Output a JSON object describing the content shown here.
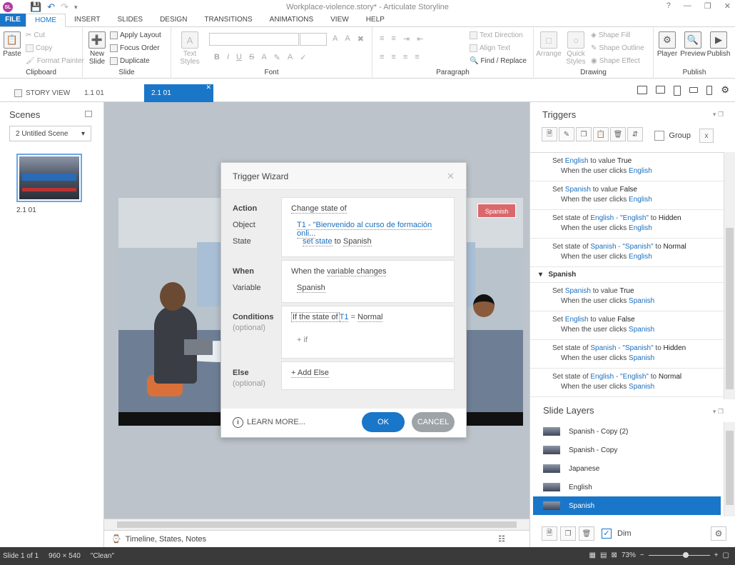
{
  "window": {
    "title": "Workplace-violence.story* - Articulate Storyline",
    "logo": "SL"
  },
  "tabs": [
    "FILE",
    "HOME",
    "INSERT",
    "SLIDES",
    "DESIGN",
    "TRANSITIONS",
    "ANIMATIONS",
    "VIEW",
    "HELP"
  ],
  "ribbon": {
    "clipboard": {
      "label": "Clipboard",
      "paste": "Paste",
      "cut": "Cut",
      "copy": "Copy",
      "format_painter": "Format Painter"
    },
    "slide": {
      "label": "Slide",
      "new_slide": "New Slide",
      "apply_layout": "Apply Layout",
      "focus_order": "Focus Order",
      "duplicate": "Duplicate"
    },
    "font": {
      "label": "Font",
      "text_styles": "Text Styles"
    },
    "paragraph": {
      "label": "Paragraph",
      "text_direction": "Text Direction",
      "align_text": "Align Text",
      "find_replace": "Find / Replace"
    },
    "drawing": {
      "label": "Drawing",
      "arrange": "Arrange",
      "quick_styles": "Quick Styles",
      "shape_fill": "Shape Fill",
      "shape_outline": "Shape Outline",
      "shape_effect": "Shape Effect"
    },
    "publish": {
      "label": "Publish",
      "player": "Player",
      "preview": "Preview",
      "publish": "Publish"
    }
  },
  "viewbar": {
    "story_view": "STORY VIEW",
    "tab1": "1.1 01",
    "tab2": "2.1 01"
  },
  "scenes": {
    "title": "Scenes",
    "dropdown": "2 Untitled Scene",
    "thumb_label": "2.1 01"
  },
  "slide": {
    "spanish_button": "Spanish"
  },
  "timeline_bar": "Timeline, States, Notes",
  "dialog": {
    "title": "Trigger Wizard",
    "action": {
      "label": "Action",
      "object_label": "Object",
      "state_label": "State",
      "action_value": "Change state of",
      "object_value": "T1 - \"Bienvenido al curso de formación onli...",
      "state_prefix": "set state",
      "state_to": "to",
      "state_value": "Spanish"
    },
    "when": {
      "label": "When",
      "variable_label": "Variable",
      "when_prefix": "When the",
      "when_value": "variable changes",
      "variable_value": "Spanish"
    },
    "conditions": {
      "label": "Conditions",
      "optional": "(optional)",
      "if_prefix": "If the state of",
      "object": "T1",
      "operator": "=",
      "value": "Normal",
      "add_if": "+ if"
    },
    "else": {
      "label": "Else",
      "optional": "(optional)",
      "add_else": "+ Add Else"
    },
    "learn_more": "LEARN MORE...",
    "ok": "OK",
    "cancel": "CANCEL"
  },
  "triggers": {
    "title": "Triggers",
    "group_label": "Group",
    "items": [
      {
        "l1a": "Set",
        "l1b": "English",
        "l1c": "to value",
        "l1d": "True",
        "l2a": "When the user clicks",
        "l2b": "English"
      },
      {
        "l1a": "Set",
        "l1b": "Spanish",
        "l1c": "to value",
        "l1d": "False",
        "l2a": "When the user clicks",
        "l2b": "English"
      },
      {
        "l1a": "Set state of",
        "l1b": "English - \"English\"",
        "l1c": "to",
        "l1d": "Hidden",
        "l2a": "When the user clicks",
        "l2b": "English"
      },
      {
        "l1a": "Set state of",
        "l1b": "Spanish - \"Spanish\"",
        "l1c": "to",
        "l1d": "Normal",
        "l2a": "When the user clicks",
        "l2b": "English"
      }
    ],
    "group_spanish": "Spanish",
    "items2": [
      {
        "l1a": "Set",
        "l1b": "Spanish",
        "l1c": "to value",
        "l1d": "True",
        "l2a": "When the user clicks",
        "l2b": "Spanish"
      },
      {
        "l1a": "Set",
        "l1b": "English",
        "l1c": "to value",
        "l1d": "False",
        "l2a": "When the user clicks",
        "l2b": "Spanish"
      },
      {
        "l1a": "Set state of",
        "l1b": "Spanish - \"Spanish\"",
        "l1c": "to",
        "l1d": "Hidden",
        "l2a": "When the user clicks",
        "l2b": "Spanish"
      },
      {
        "l1a": "Set state of",
        "l1b": "English - \"English\"",
        "l1c": "to",
        "l1d": "Normal",
        "l2a": "When the user clicks",
        "l2b": "Spanish"
      }
    ]
  },
  "layers": {
    "title": "Slide Layers",
    "items": [
      "Spanish - Copy (2)",
      "Spanish - Copy",
      "Japanese",
      "English",
      "Spanish"
    ],
    "selected_index": 4,
    "dim_label": "Dim"
  },
  "status": {
    "slide": "Slide 1 of 1",
    "size": "960 × 540",
    "theme": "\"Clean\"",
    "zoom": "73%"
  },
  "colors": {
    "accent": "#1976c8",
    "spanish_button": "#d9686c"
  }
}
